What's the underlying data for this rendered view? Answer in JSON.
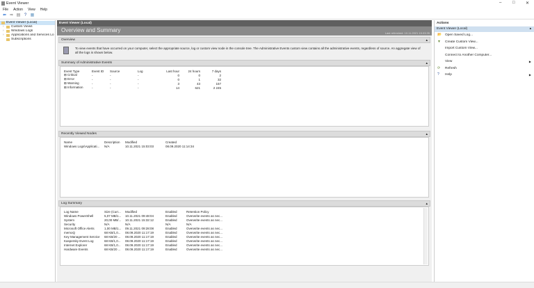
{
  "window": {
    "title": "Event Viewer"
  },
  "menu": [
    "File",
    "Action",
    "View",
    "Help"
  ],
  "tree": [
    {
      "label": "Event Viewer (Local)",
      "selected": true
    },
    {
      "label": "Custom Views"
    },
    {
      "label": "Windows Logs"
    },
    {
      "label": "Applications and Services Lo"
    },
    {
      "label": "Subscriptions"
    }
  ],
  "center": {
    "header": "Event Viewer (Local)",
    "title": "Overview and Summary",
    "last_refreshed": "Last refreshed: 10.11.2021 15:33:35",
    "overview": {
      "title": "Overview",
      "text": "To view events that have occurred on your computer, select the appropriate source, log or custom view node in the console tree. The Administrative Events custom view contains all the administrative events, regardless of source. An aggregate view of all the logs is shown below."
    },
    "summary": {
      "title": "Summary of Administrative Events",
      "columns": [
        "Event Type",
        "Event ID",
        "Source",
        "Log",
        "Last hour",
        "24 hours",
        "7 days"
      ],
      "rows": [
        [
          "Critical",
          "-",
          "-",
          "-",
          "0",
          "0",
          "2"
        ],
        [
          "Error",
          "-",
          "-",
          "-",
          "0",
          "1",
          "32"
        ],
        [
          "Warning",
          "-",
          "-",
          "-",
          "3",
          "43",
          "157"
        ],
        [
          "Information",
          "-",
          "-",
          "-",
          "14",
          "621",
          "2 245"
        ]
      ]
    },
    "recent": {
      "title": "Recently Viewed Nodes",
      "columns": [
        "Name",
        "Description",
        "Modified",
        "Created"
      ],
      "rows": [
        [
          "Windows Logs\\Applicati...",
          "N/A",
          "10.11.2021 15:03:03",
          "08.09.2020 11:14:34"
        ]
      ]
    },
    "logs": {
      "title": "Log Summary",
      "columns": [
        "Log Name",
        "Size (Curr...",
        "Modified",
        "Enabled",
        "Retention Policy"
      ],
      "rows": [
        [
          "Windows PowerShell",
          "5,07 MB/1...",
          "10.11.2021 09:48:04",
          "Enabled",
          "Overwrite events as nec..."
        ],
        [
          "System",
          "20,00 MB/...",
          "10.11.2021 15:32:12",
          "Enabled",
          "Overwrite events as nec..."
        ],
        [
          "Security",
          "N/A",
          "N/A",
          "N/A",
          "N/A"
        ],
        [
          "Microsoft Office Alerts",
          "1,00 MB/1...",
          "09.11.2021 09:28:08",
          "Enabled",
          "Overwrite events as nec..."
        ],
        [
          "memoQ",
          "68 KB/1,0...",
          "08.09.2020 11:17:19",
          "Enabled",
          "Overwrite events as nec..."
        ],
        [
          "Key Management Service",
          "68 KB/20 ...",
          "08.09.2020 11:17:19",
          "Enabled",
          "Overwrite events as nec..."
        ],
        [
          "Kaspersky Event Log",
          "68 KB/1,0...",
          "08.09.2020 11:17:19",
          "Enabled",
          "Overwrite events as nec..."
        ],
        [
          "Internet Explorer",
          "68 KB/1,0...",
          "08.09.2020 11:17:19",
          "Enabled",
          "Overwrite events as nec..."
        ],
        [
          "Hardware Events",
          "68 KB/20 ...",
          "08.09.2020 11:17:19",
          "Enabled",
          "Overwrite events as nec..."
        ]
      ]
    }
  },
  "actions": {
    "title": "Actions",
    "group": "Event Viewer (Local)",
    "items": [
      {
        "label": "Open Saved Log...",
        "icon": "folder-icon"
      },
      {
        "label": "Create Custom View...",
        "icon": "filter-icon"
      },
      {
        "label": "Import Custom View...",
        "icon": ""
      },
      {
        "label": "Connect to Another Computer...",
        "icon": ""
      },
      {
        "label": "View",
        "icon": "",
        "submenu": true
      },
      {
        "label": "Refresh",
        "icon": "refresh-icon"
      },
      {
        "label": "Help",
        "icon": "help-icon",
        "submenu": true
      }
    ]
  }
}
